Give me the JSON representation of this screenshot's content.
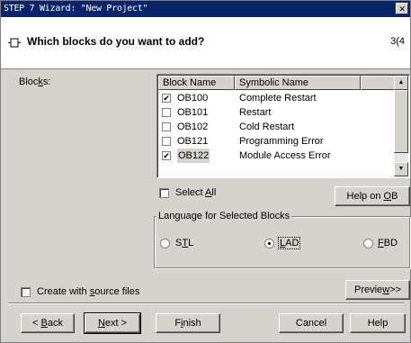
{
  "window": {
    "title": "STEP 7 Wizard: \"New Project\"",
    "close_glyph": "✕"
  },
  "header": {
    "icon": "block-icon",
    "title": "Which blocks do you want to add?",
    "page": "3(4"
  },
  "blocks": {
    "label": "Blocks:",
    "columns": [
      "Block Name",
      "Symbolic Name"
    ],
    "rows": [
      {
        "name": "OB100",
        "symbolic": "Complete Restart",
        "checked": true
      },
      {
        "name": "OB101",
        "symbolic": "Restart",
        "checked": false
      },
      {
        "name": "OB102",
        "symbolic": "Cold Restart",
        "checked": false
      },
      {
        "name": "OB121",
        "symbolic": "Programming Error",
        "checked": false
      },
      {
        "name": "OB122",
        "symbolic": "Module Access Error",
        "checked": true
      }
    ],
    "select_all_label": "Select All",
    "select_all_checked": false,
    "help_on_ob": "Help on OB"
  },
  "language": {
    "group_title": "Language for Selected Blocks",
    "options": [
      {
        "label": "STL",
        "selected": false
      },
      {
        "label": "LAD",
        "selected": true
      },
      {
        "label": "FBD",
        "selected": false
      }
    ]
  },
  "source_files": {
    "label": "Create with source files",
    "checked": false
  },
  "preview_button": "Preview>>",
  "footer": {
    "back": "< Back",
    "next": "Next >",
    "finish": "Finish",
    "cancel": "Cancel",
    "help": "Help"
  },
  "colors": {
    "titlebar": "#0a246a",
    "dialog_bg": "#d6d3ce",
    "header_bg": "#ffffff"
  }
}
